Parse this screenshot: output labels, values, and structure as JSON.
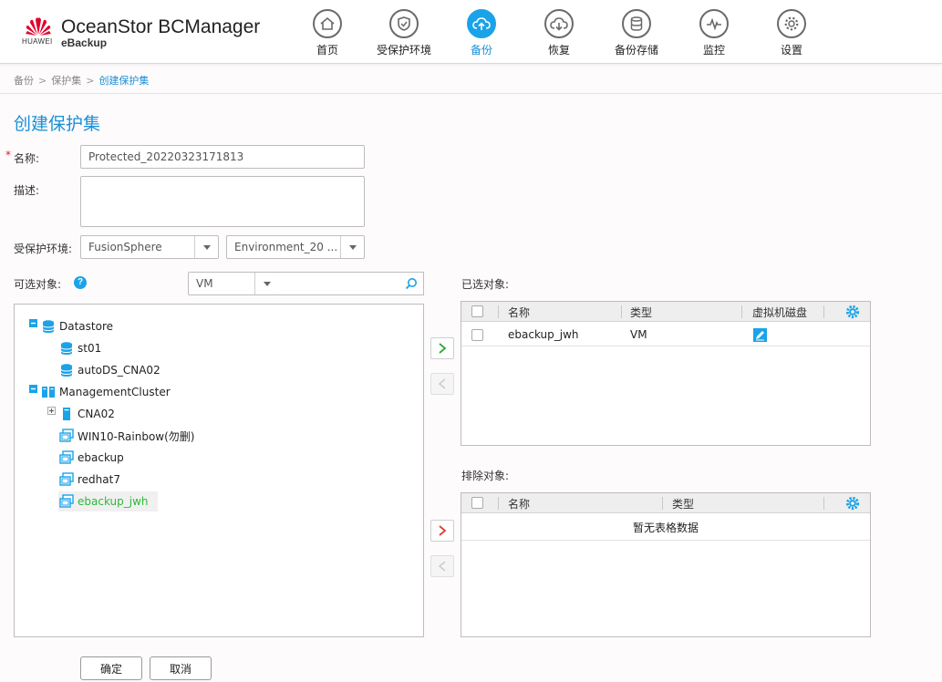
{
  "header": {
    "logo_text": "HUAWEI",
    "product": "OceanStor BCManager",
    "subproduct": "eBackup",
    "nav": [
      {
        "label": "首页",
        "icon": "home-icon"
      },
      {
        "label": "受保护环境",
        "icon": "shield-icon"
      },
      {
        "label": "备份",
        "icon": "cloud-upload-icon",
        "active": true
      },
      {
        "label": "恢复",
        "icon": "cloud-download-icon"
      },
      {
        "label": "备份存储",
        "icon": "database-icon"
      },
      {
        "label": "监控",
        "icon": "pulse-icon"
      },
      {
        "label": "设置",
        "icon": "gear-icon"
      }
    ]
  },
  "breadcrumb": [
    "备份",
    "保护集",
    "创建保护集"
  ],
  "page_title": "创建保护集",
  "form": {
    "required_mark": "*",
    "name_label": "名称:",
    "name_value": "Protected_20220323171813",
    "desc_label": "描述:",
    "desc_value": "",
    "env_label": "受保护环境:",
    "env_type": "FusionSphere",
    "env_instance": "Environment_20 ..."
  },
  "available": {
    "label": "可选对象:",
    "help": "?",
    "type_filter": "VM",
    "search_value": "",
    "tree": [
      {
        "label": "Datastore",
        "icon": "datastore-icon",
        "expander": "−"
      },
      {
        "label": "st01",
        "icon": "datastore-icon"
      },
      {
        "label": "autoDS_CNA02",
        "icon": "datastore-icon"
      },
      {
        "label": "ManagementCluster",
        "icon": "cluster-icon",
        "expander": "−"
      },
      {
        "label": "CNA02",
        "icon": "host-icon",
        "expander": "+"
      },
      {
        "label": "WIN10-Rainbow(勿删)",
        "icon": "vm-icon"
      },
      {
        "label": "ebackup",
        "icon": "vm-icon"
      },
      {
        "label": "redhat7",
        "icon": "vm-icon"
      },
      {
        "label": "ebackup_jwh",
        "icon": "vm-icon",
        "selected": true
      }
    ]
  },
  "selected": {
    "label": "已选对象:",
    "columns": [
      "名称",
      "类型",
      "虚拟机磁盘"
    ],
    "rows": [
      {
        "name": "ebackup_jwh",
        "type": "VM",
        "disk_icon": "edit-disk-icon"
      }
    ]
  },
  "excluded": {
    "label": "排除对象:",
    "columns": [
      "名称",
      "类型"
    ],
    "empty_text": "暂无表格数据"
  },
  "actions": {
    "confirm": "确定",
    "cancel": "取消"
  },
  "colors": {
    "accent": "#1aa3e8",
    "link": "#1a8fd6",
    "add_arrow": "#2fa83a",
    "remove_arrow": "#e03a3a",
    "selected_text": "#2fb83a"
  }
}
